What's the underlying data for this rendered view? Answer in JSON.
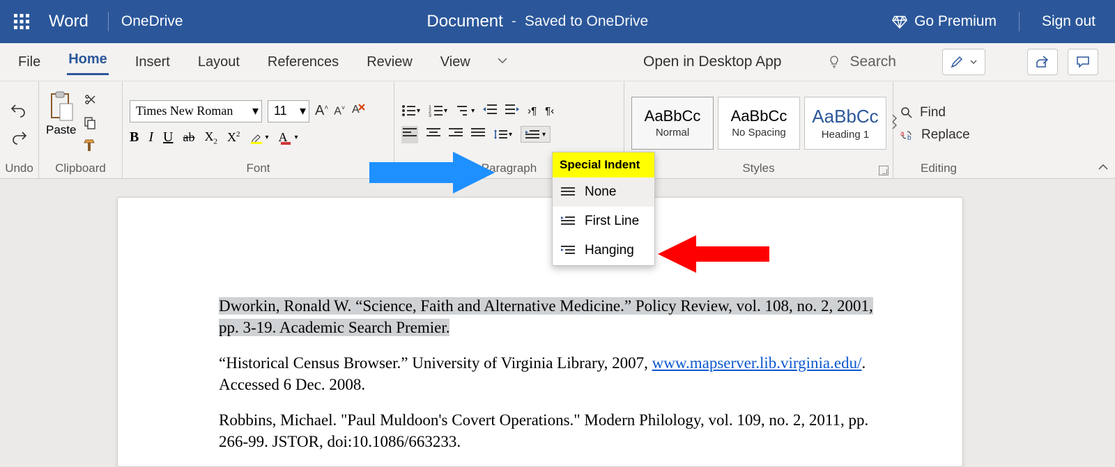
{
  "titlebar": {
    "app_name": "Word",
    "location": "OneDrive",
    "document_name": "Document",
    "dash": "-",
    "save_status": "Saved to OneDrive",
    "premium": "Go Premium",
    "sign_out": "Sign out"
  },
  "tabs": {
    "file": "File",
    "home": "Home",
    "insert": "Insert",
    "layout": "Layout",
    "references": "References",
    "review": "Review",
    "view": "View",
    "open_desktop": "Open in Desktop App",
    "search_placeholder": "Search"
  },
  "ribbon": {
    "undo_label": "Undo",
    "clipboard_label": "Clipboard",
    "paste": "Paste",
    "font_label": "Font",
    "font_name": "Times New Roman",
    "font_size": "11",
    "paragraph_label": "Paragraph",
    "styles_label": "Styles",
    "editing_label": "Editing",
    "find": "Find",
    "replace": "Replace",
    "styles": {
      "normal_sample": "AaBbCc",
      "normal_name": "Normal",
      "nospacing_sample": "AaBbCc",
      "nospacing_name": "No Spacing",
      "heading1_sample": "AaBbCc",
      "heading1_name": "Heading 1"
    }
  },
  "menu": {
    "header": "Special Indent",
    "none": "None",
    "first_line": "First Line",
    "hanging": "Hanging"
  },
  "document": {
    "p1a": "Dworkin, Ronald W. “Science, Faith and Alternative Medicine.” Policy Review, vol. 108, no. 2, 2001,",
    "p1b": "pp. 3-19. Academic Search Premier.",
    "p2a": "“Historical Census Browser.” University of Virginia Library, 2007, ",
    "p2link": "www.mapserver.lib.virginia.edu/",
    "p2b": ". Accessed 6 Dec. 2008.",
    "p3": "Robbins, Michael. \"Paul Muldoon's Covert Operations.\" Modern Philology, vol. 109, no. 2, 2011, pp. 266-99. JSTOR, doi:10.1086/663233."
  }
}
